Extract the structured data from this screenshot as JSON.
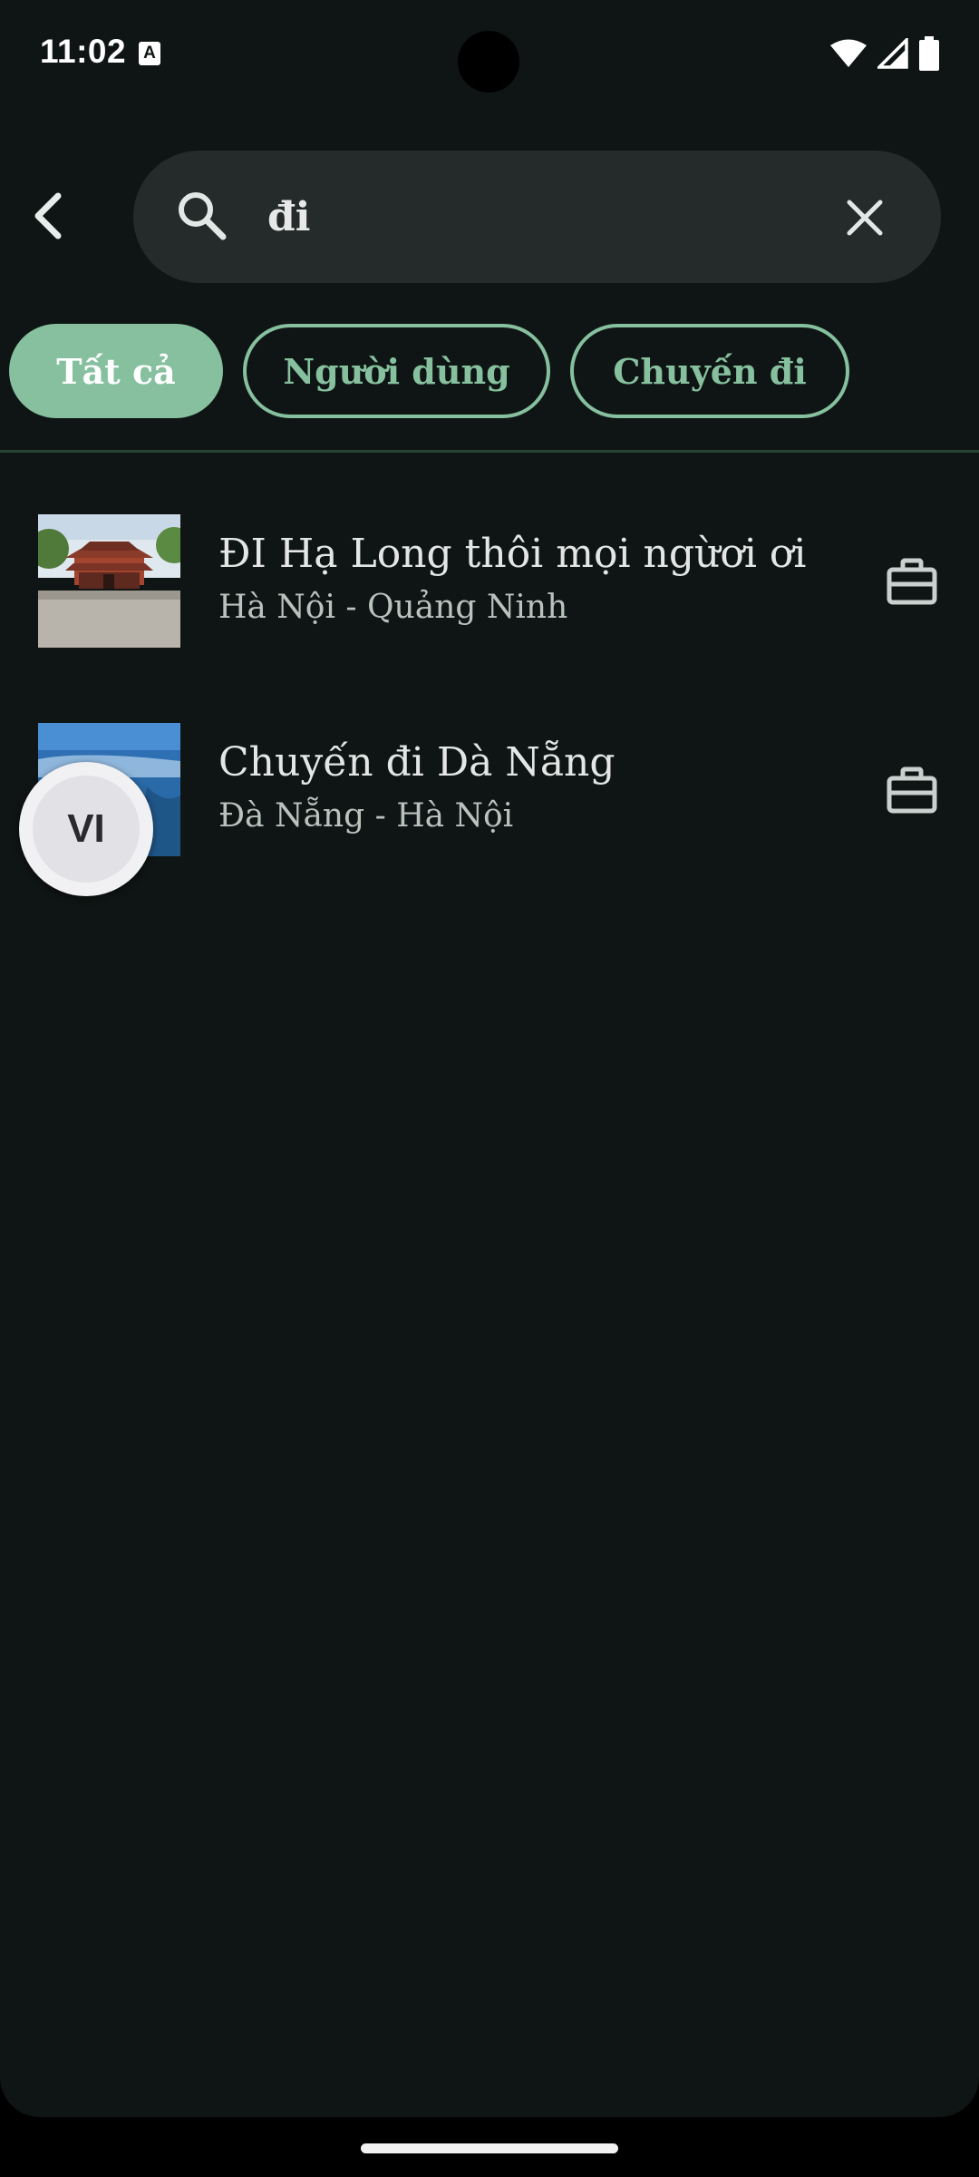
{
  "status_bar": {
    "time": "11:02",
    "notification_icon_glyph": "A"
  },
  "search": {
    "query": "đi",
    "placeholder": ""
  },
  "filters": [
    {
      "label": "Tất cả",
      "active": true
    },
    {
      "label": "Người dùng",
      "active": false
    },
    {
      "label": "Chuyến đi",
      "active": false
    }
  ],
  "results": [
    {
      "title": "ĐI Hạ Long thôi mọi ngừơi ơi",
      "subtitle": "Hà Nội - Quảng Ninh",
      "icon": "briefcase-icon"
    },
    {
      "title": "Chuyến đi Dà Nẵng",
      "subtitle": "Đà Nẵng - Hà Nội",
      "icon": "briefcase-icon"
    }
  ],
  "language_badge": "VI",
  "colors": {
    "background": "#0f1514",
    "accent": "#86c09e",
    "search_field": "#252b2a"
  }
}
